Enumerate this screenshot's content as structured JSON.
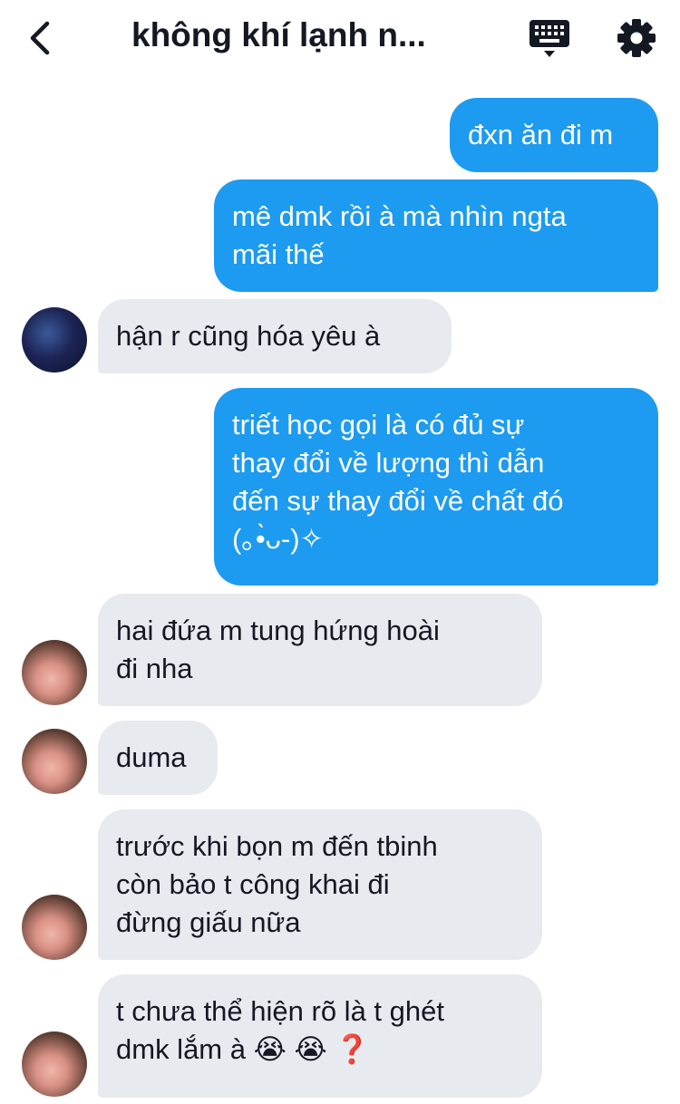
{
  "header": {
    "title": "không khí lạnh n...",
    "back_icon": "chevron-left-icon",
    "keyboard_icon": "keyboard-icon",
    "settings_icon": "gear-icon"
  },
  "colors": {
    "outgoing_bubble": "#1d9bf0",
    "incoming_bubble": "#e7eaee",
    "background": "#ffffff",
    "text": "#141823"
  },
  "messages": [
    {
      "direction": "outgoing",
      "text": "đxn ăn đi m"
    },
    {
      "direction": "outgoing",
      "text": "mê dmk rồi à mà nhìn ngta\nmãi thế"
    },
    {
      "direction": "incoming",
      "sender": "avatar-a",
      "text": "hận r cũng hóa yêu à"
    },
    {
      "direction": "outgoing",
      "text": "triết học gọi là có đủ sự\nthay đổi về lượng thì dẫn\nđến sự thay đổi về chất đó\n(｡•̀ᴗ-)✧"
    },
    {
      "direction": "incoming",
      "sender": "avatar-b",
      "text": "hai đứa m tung hứng hoài\nđi nha"
    },
    {
      "direction": "incoming",
      "sender": "avatar-b",
      "text": "duma"
    },
    {
      "direction": "incoming",
      "sender": "avatar-b",
      "text": "trước khi bọn m đến tbinh\ncòn bảo t công khai đi\nđừng giấu nữa"
    },
    {
      "direction": "incoming",
      "sender": "avatar-b",
      "text": "t chưa thể hiện rõ là t ghét\ndmk lắm à",
      "emojis": [
        "😭",
        "😭",
        "❓"
      ]
    }
  ]
}
